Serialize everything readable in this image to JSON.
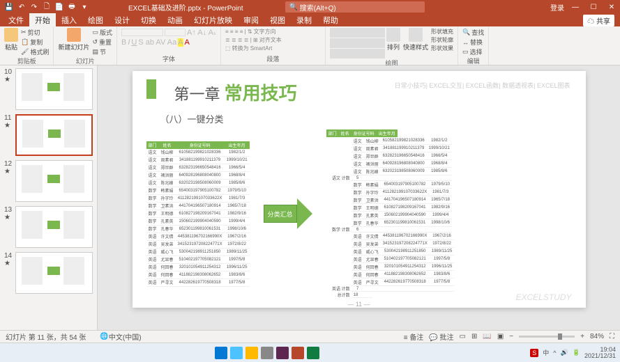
{
  "titlebar": {
    "filename": "EXCEL基础及进阶.pptx - PowerPoint",
    "search_placeholder": "搜索(Alt+Q)",
    "login": "登录"
  },
  "tabs": {
    "file": "文件",
    "home": "开始",
    "insert": "插入",
    "draw": "绘图",
    "design": "设计",
    "transitions": "切换",
    "animations": "动画",
    "slideshow": "幻灯片放映",
    "review": "审阅",
    "view": "视图",
    "record": "录制",
    "help": "帮助",
    "share": "共享"
  },
  "ribbon": {
    "paste": "粘贴",
    "cut": "剪切",
    "copy": "复制",
    "format_painter": "格式刷",
    "clipboard": "剪贴板",
    "new_slide": "新建幻灯片",
    "layout": "版式",
    "reset": "重置",
    "section": "节",
    "slides": "幻灯片",
    "font": "字体",
    "paragraph": "段落",
    "text_direction": "文字方向",
    "align_text": "对齐文本",
    "convert_smartart": "转换为 SmartArt",
    "drawing": "绘图",
    "arrange": "排列",
    "quick_styles": "快速样式",
    "shape_fill": "形状填充",
    "shape_outline": "形状轮廓",
    "shape_effects": "形状效果",
    "find": "查找",
    "replace": "替换",
    "select": "选择",
    "editing": "编辑"
  },
  "slide": {
    "chapter": "第一章",
    "title": "常用技巧",
    "subtitle": "（八）一键分类",
    "tags": "日常小技巧| EXCEL交互| EXCEL函数| 数据透视表| EXCEL图表",
    "arrow_label": "分类汇总",
    "page": "— 11 —",
    "watermark": "EXCELSTUDY",
    "headers": [
      "部门",
      "姓名",
      "身份证号码",
      "出生年月"
    ],
    "left_rows": [
      [
        "语文",
        "钱山柳",
        "610582199821028336",
        "1982/1/2"
      ],
      [
        "语文",
        "周素君",
        "341881199910211379",
        "1999/10/21"
      ],
      [
        "语文",
        "郑世群",
        "632823196650548416",
        "1966/5/4"
      ],
      [
        "语文",
        "褚洪丽",
        "640928196808040800",
        "1968/8/4"
      ],
      [
        "语文",
        "陈兆峰",
        "632023198508060009",
        "1985/8/6"
      ],
      [
        "数学",
        "韩素娟",
        "654003197905100782",
        "1979/5/10"
      ],
      [
        "数学",
        "孙字玲",
        "411282199107033622X",
        "1981/7/3"
      ],
      [
        "数学",
        "卫素洪",
        "441704196507180914",
        "1965/7/18"
      ],
      [
        "数学",
        "王明德",
        "610827198209167041",
        "1982/9/16"
      ],
      [
        "数学",
        "孔素英",
        "150602199904040590",
        "1999/4/4"
      ],
      [
        "数学",
        "孔春华",
        "652301199810061531",
        "1998/10/6"
      ],
      [
        "英语",
        "许文倩",
        "445381196702166990X",
        "1967/2/16"
      ],
      [
        "英语",
        "吴发弟",
        "341523197208224771X",
        "1972/8/22"
      ],
      [
        "英语",
        "威心飞",
        "530042198911251850",
        "1989/11/25"
      ],
      [
        "英语",
        "尤显春",
        "510402197705082121",
        "1997/5/8"
      ],
      [
        "英语",
        "何回春",
        "320101054911254312",
        "1996/11/25"
      ],
      [
        "英语",
        "何回春",
        "411882198308062652",
        "1983/8/6"
      ],
      [
        "英语",
        "严寻文",
        "442282619770508318",
        "1977/5/8"
      ]
    ],
    "right_sections": [
      {
        "label": "语文 计数",
        "count": "5",
        "rows": [
          [
            "语文",
            "钱山柳",
            "610582199821028336",
            "1982/1/2"
          ],
          [
            "语文",
            "周素君",
            "341881199910211379",
            "1999/10/21"
          ],
          [
            "语文",
            "郑世群",
            "632823196650548416",
            "1966/5/4"
          ],
          [
            "语文",
            "褚洪丽",
            "640928196808040800",
            "1968/8/4"
          ],
          [
            "语文",
            "陈兆峰",
            "632023198508060009",
            "1985/8/6"
          ]
        ]
      },
      {
        "label": "数学 计数",
        "count": "6",
        "rows": [
          [
            "数学",
            "韩素娟",
            "654003197905100782",
            "1979/5/10"
          ],
          [
            "数学",
            "孙字玲",
            "411282199107033622X",
            "1981/7/3"
          ],
          [
            "数学",
            "卫素洪",
            "441704196507180914",
            "1965/7/18"
          ],
          [
            "数学",
            "王明德",
            "610827198209167041",
            "1982/9/16"
          ],
          [
            "数学",
            "孔素英",
            "150602199904040590",
            "1999/4/4"
          ],
          [
            "数学",
            "孔春华",
            "652301199810061531",
            "1998/10/6"
          ]
        ]
      },
      {
        "label": "英语 计数",
        "count": "7",
        "rows": [
          [
            "英语",
            "许文倩",
            "445381196702166990X",
            "1967/2/16"
          ],
          [
            "英语",
            "吴发弟",
            "341523197208224771X",
            "1972/8/22"
          ],
          [
            "英语",
            "威心飞",
            "530042198911251850",
            "1989/11/25"
          ],
          [
            "英语",
            "尤显春",
            "510402197705082121",
            "1997/5/8"
          ],
          [
            "英语",
            "何回春",
            "320101054911254312",
            "1996/11/25"
          ],
          [
            "英语",
            "何回春",
            "411882198308062652",
            "1983/8/6"
          ],
          [
            "英语",
            "严寻文",
            "442282619770508318",
            "1977/5/8"
          ]
        ]
      },
      {
        "label": "总计数",
        "count": "18",
        "rows": []
      }
    ]
  },
  "thumbs": [
    "10",
    "11",
    "12",
    "13",
    "14"
  ],
  "statusbar": {
    "slide_info": "幻灯片 第 11 张，共 54 张",
    "language": "中文(中国)",
    "notes": "备注",
    "comments": "批注",
    "zoom": "84%"
  },
  "taskbar": {
    "time": "19:04",
    "date": "2021/12/31"
  }
}
